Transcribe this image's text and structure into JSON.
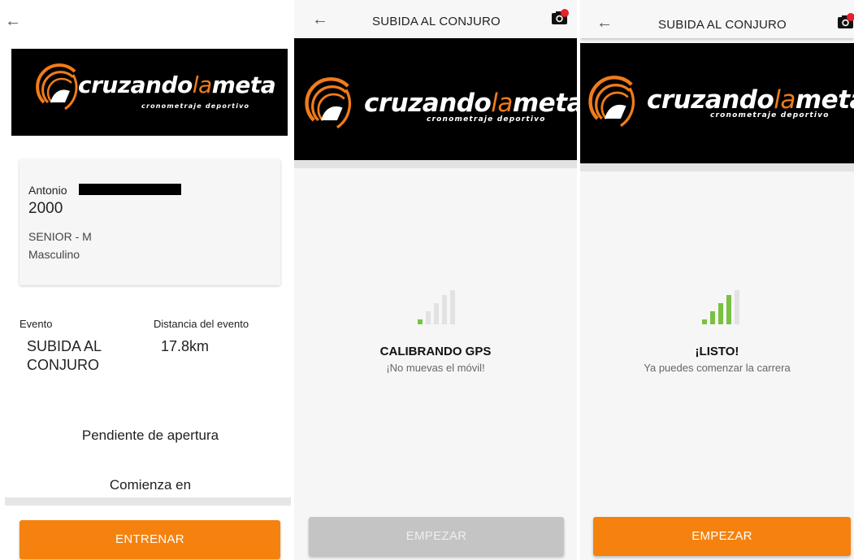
{
  "screen1": {
    "card": {
      "first_name": "Antonio",
      "birth_year": "2000",
      "category": "SENIOR -  M",
      "gender": "Masculino"
    },
    "event_label": "Evento",
    "event_value": "SUBIDA AL CONJURO",
    "distance_label": "Distancia del evento",
    "distance_value": "17.8km",
    "status": "Pendiente de apertura",
    "starts_in": "Comienza en",
    "button_label": "ENTRENAR"
  },
  "screen2": {
    "title": "SUBIDA AL CONJURO",
    "heading": "CALIBRANDO GPS",
    "subtext": "¡No muevas el móvil!",
    "button_label": "EMPEZAR",
    "signal_level": 1
  },
  "screen3": {
    "title": "SUBIDA AL CONJURO",
    "heading": "¡LISTO!",
    "subtext": "Ya puedes comenzar la carrera",
    "button_label": "EMPEZAR",
    "signal_level": 4
  },
  "logo": {
    "main_part1": "cruzando",
    "main_accent": "la",
    "main_part2": "meta",
    "tagline": "cronometraje deportivo"
  },
  "icons": {
    "back": "arrow-left-icon",
    "camera": "camera-icon",
    "signal": "signal-strength-icon"
  },
  "colors": {
    "accent": "#f5820f",
    "signal_active": "#7ac143",
    "signal_inactive": "#e2e2e2",
    "disabled_button": "#c4c4c4",
    "notification_dot": "#e8202a"
  }
}
